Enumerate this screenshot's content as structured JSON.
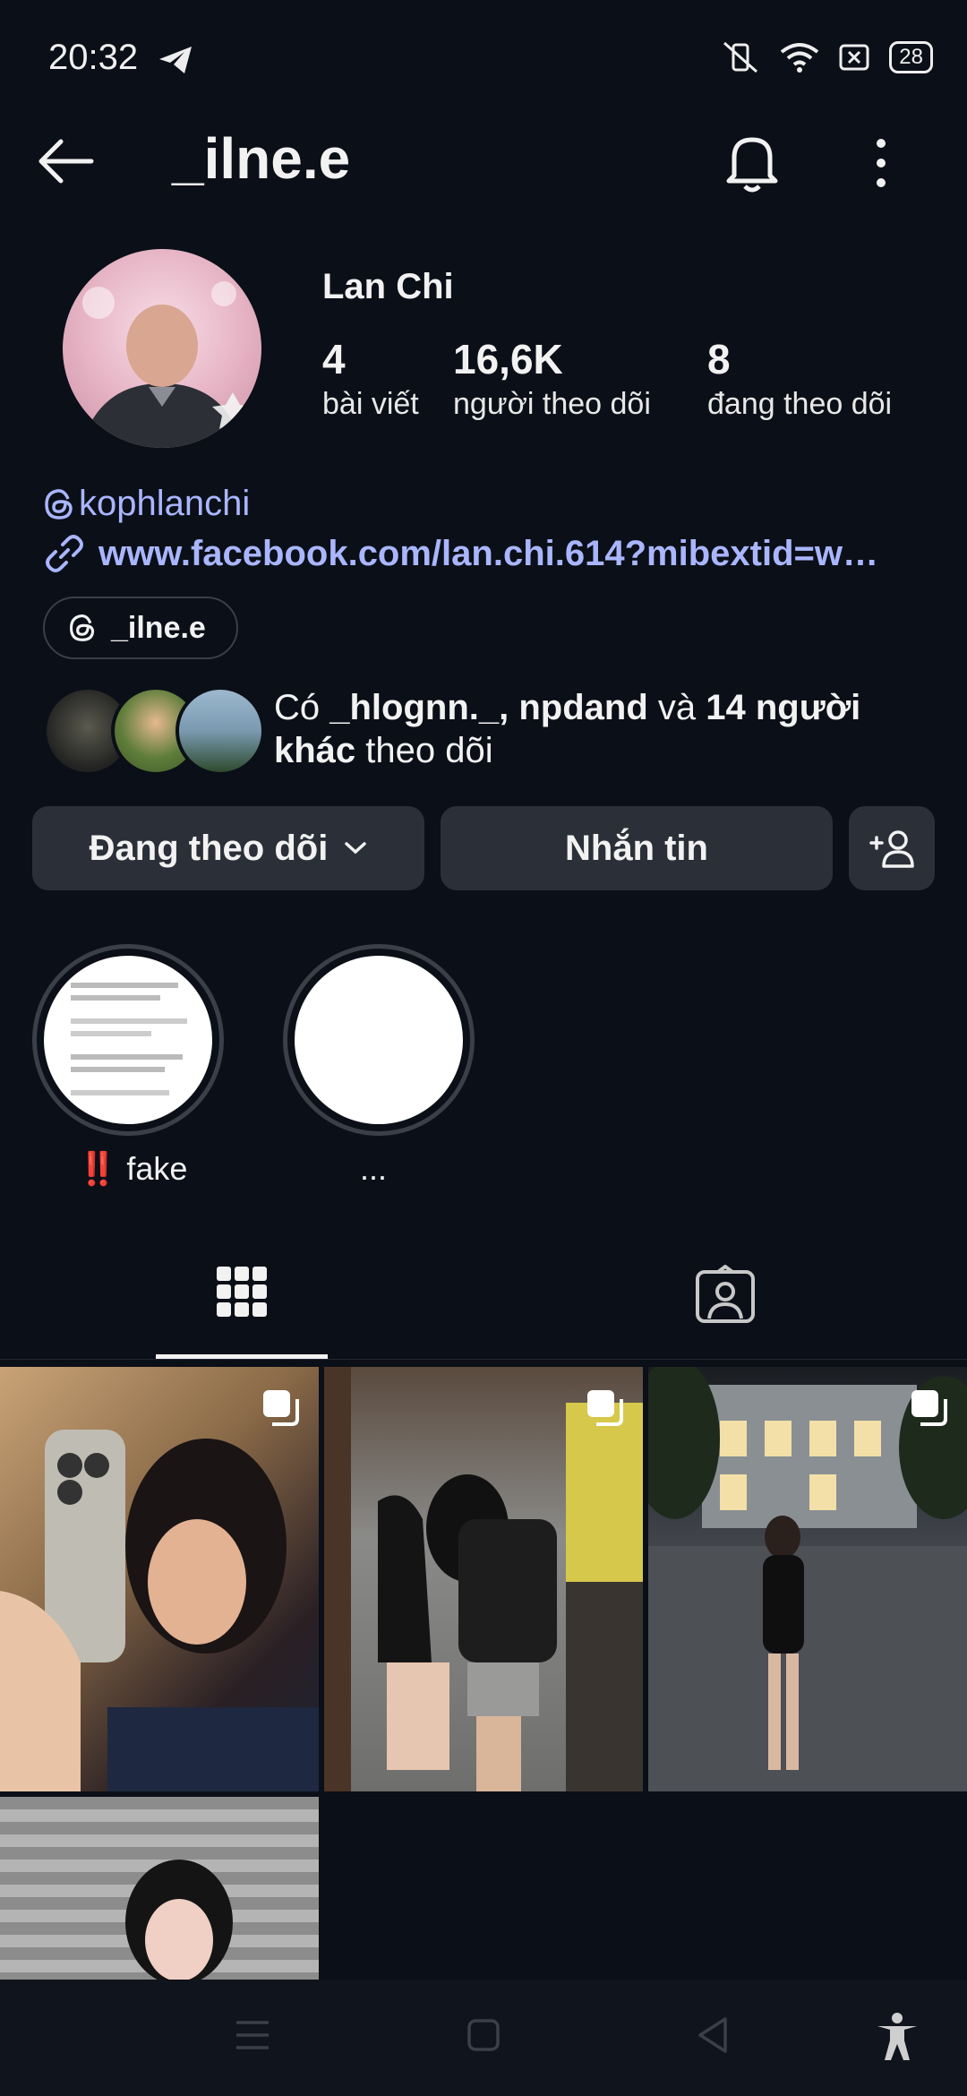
{
  "status_bar": {
    "time": "20:32",
    "battery": "28"
  },
  "header": {
    "username": "_ilne.e"
  },
  "profile": {
    "display_name": "Lan Chi",
    "stats": [
      {
        "value": "4",
        "label": "bài viết"
      },
      {
        "value": "16,6K",
        "label": "người theo dõi"
      },
      {
        "value": "8",
        "label": "đang theo dõi"
      }
    ],
    "threads_handle": "kophlanchi",
    "link": "www.facebook.com/lan.chi.614?mibextid=w…",
    "threads_badge": "_ilne.e"
  },
  "mutual": {
    "prefix": "Có ",
    "names": "_hlognn._, npdand",
    "middle": " và ",
    "bold_tail": "14 người khác",
    "suffix": " theo dõi"
  },
  "buttons": {
    "following": "Đang theo dõi",
    "message": "Nhắn tin"
  },
  "highlights": [
    {
      "label": "‼️ fake"
    },
    {
      "label": "..."
    }
  ],
  "tabs": [
    {
      "icon": "grid-icon",
      "active": true
    },
    {
      "icon": "tagged-icon",
      "active": false
    }
  ],
  "posts": [
    {
      "multi": true
    },
    {
      "multi": true
    },
    {
      "multi": true
    },
    {
      "multi": false
    }
  ]
}
